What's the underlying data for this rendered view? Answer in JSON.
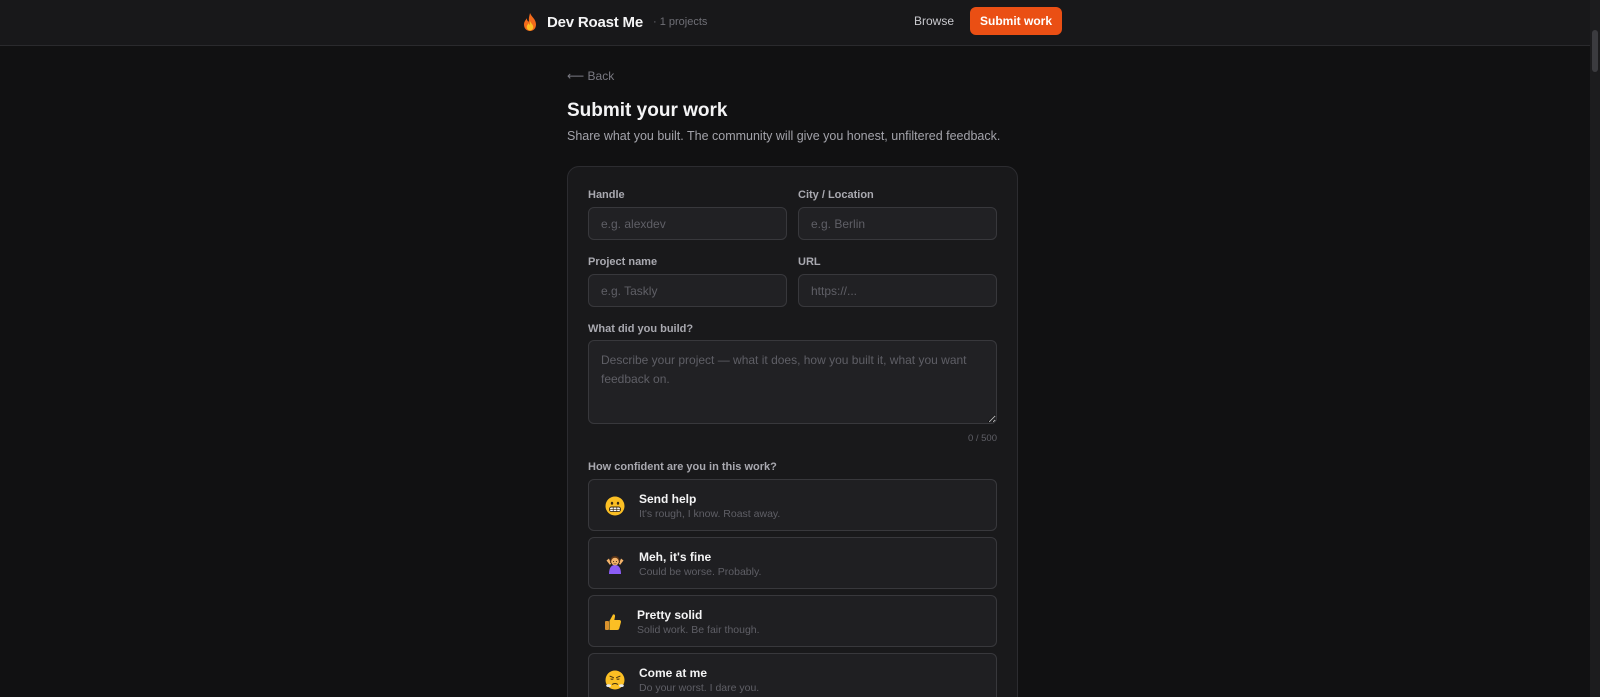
{
  "header": {
    "brand_name": "Dev Roast Me",
    "project_count": "· 1 projects",
    "browse_label": "Browse",
    "submit_label": "Submit work"
  },
  "page": {
    "back_label": "⟵ Back",
    "title": "Submit your work",
    "subtitle": "Share what you built. The community will give you honest, unfiltered feedback."
  },
  "form": {
    "handle": {
      "label": "Handle",
      "placeholder": "e.g. alexdev",
      "value": ""
    },
    "city": {
      "label": "City / Location",
      "placeholder": "e.g. Berlin",
      "value": ""
    },
    "project_name": {
      "label": "Project name",
      "placeholder": "e.g. Taskly",
      "value": ""
    },
    "url": {
      "label": "URL",
      "placeholder": "https://...",
      "value": ""
    },
    "description": {
      "label": "What did you build?",
      "placeholder": "Describe your project — what it does, how you built it, what you want feedback on.",
      "value": "",
      "counter": "0 / 500"
    },
    "confidence": {
      "label": "How confident are you in this work?",
      "options": [
        {
          "icon": "grimacing-face-icon",
          "title": "Send help",
          "desc": "It's rough, I know. Roast away."
        },
        {
          "icon": "shrugging-person-icon",
          "title": "Meh, it's fine",
          "desc": "Could be worse. Probably."
        },
        {
          "icon": "thumbs-up-icon",
          "title": "Pretty solid",
          "desc": "Solid work. Be fair though."
        },
        {
          "icon": "steaming-face-icon",
          "title": "Come at me",
          "desc": "Do your worst. I dare you."
        }
      ]
    }
  },
  "colors": {
    "accent": "#ea4f14",
    "background": "#111112",
    "card": "#19191b"
  }
}
